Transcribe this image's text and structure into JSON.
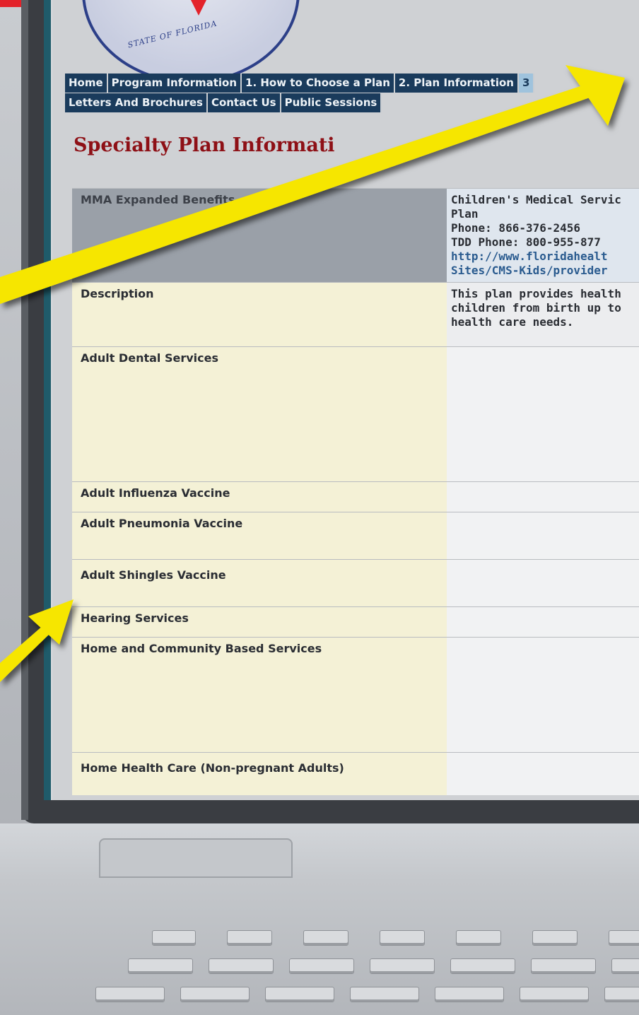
{
  "seal": {
    "text": "STATE OF FLORIDA"
  },
  "nav": {
    "row1": [
      "Home",
      "Program Information",
      "1. How to Choose a Plan",
      "2. Plan Information",
      "3"
    ],
    "row2": [
      "Letters And Brochures",
      "Contact Us",
      "Public Sessions"
    ]
  },
  "page": {
    "title": "Specialty Plan Informati"
  },
  "table": {
    "header": {
      "label": "MMA Expanded Benefits",
      "plan_lines": [
        "Children's Medical Servic",
        "Plan",
        "Phone: 866-376-2456",
        "TDD Phone: 800-955-877"
      ],
      "url_lines": [
        "http://www.floridahealt",
        "Sites/CMS-Kids/provider"
      ]
    },
    "rows": [
      {
        "label": "Description",
        "value_lines": [
          "This plan provides health",
          "children from birth up to",
          "health care needs."
        ]
      },
      {
        "label": "Adult Dental Services",
        "value_lines": []
      },
      {
        "label": "Adult Influenza Vaccine",
        "value_lines": []
      },
      {
        "label": "Adult Pneumonia Vaccine",
        "value_lines": []
      },
      {
        "label": "Adult Shingles Vaccine",
        "value_lines": []
      },
      {
        "label": "Hearing Services",
        "value_lines": []
      },
      {
        "label": "Home and Community Based Services",
        "value_lines": []
      },
      {
        "label": "Home Health Care (Non-pregnant Adults)",
        "value_lines": []
      }
    ]
  },
  "colors": {
    "nav_bg": "#1a3b5c",
    "title": "#8e1016",
    "arrow": "#f6e600",
    "brand_red": "#e3222a"
  }
}
